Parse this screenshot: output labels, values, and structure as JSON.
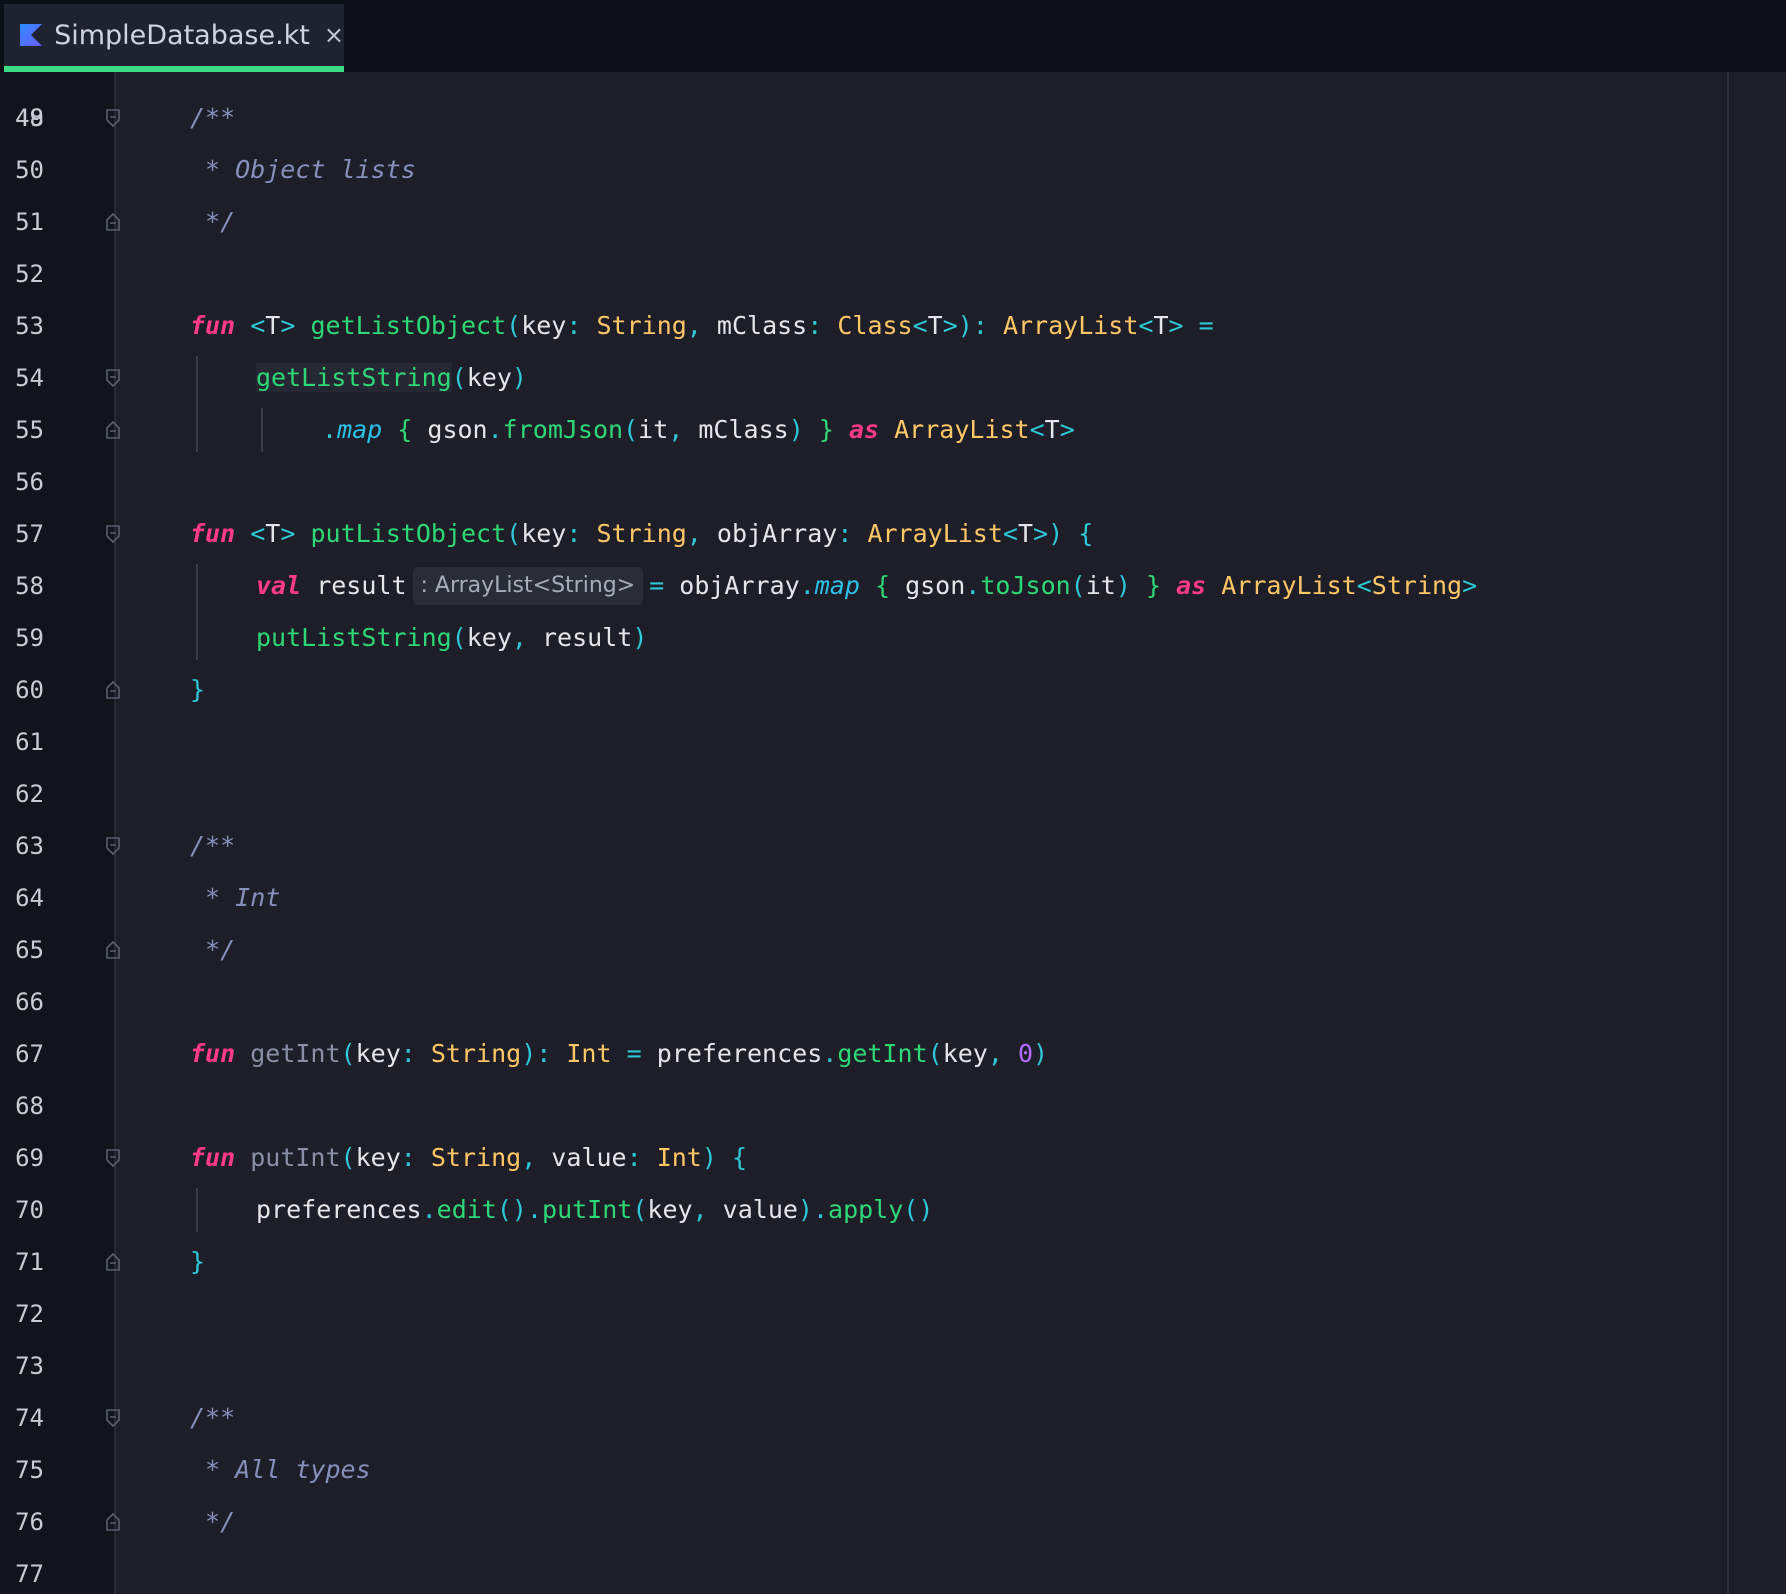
{
  "tab": {
    "title": "SimpleDatabase.kt",
    "close": "×"
  },
  "colors": {
    "background": "#1d1e27",
    "gutter": "#12141c",
    "tab_accent": "#3ddc84",
    "keyword": "#ff3a87",
    "type": "#ffc766",
    "function": "#2fd877",
    "punctuation": "#2ec8d6",
    "comment": "#8790bc",
    "number": "#b26cff"
  },
  "editor": {
    "partial_top_line": "48",
    "lines": [
      {
        "n": "49",
        "tokens": [
          [
            "cm",
            "/**"
          ]
        ]
      },
      {
        "n": "50",
        "tokens": [
          [
            "cm",
            " * Object lists"
          ]
        ]
      },
      {
        "n": "51",
        "tokens": [
          [
            "cm",
            " */"
          ]
        ]
      },
      {
        "n": "52",
        "tokens": []
      },
      {
        "n": "53",
        "tokens": [
          [
            "kw",
            "fun"
          ],
          [
            "id",
            " "
          ],
          [
            "pu",
            "<"
          ],
          [
            "id",
            "T"
          ],
          [
            "pu",
            ">"
          ],
          [
            "id",
            " "
          ],
          [
            "fn",
            "getListObject"
          ],
          [
            "pu",
            "("
          ],
          [
            "id",
            "key"
          ],
          [
            "pu",
            ":"
          ],
          [
            "id",
            " "
          ],
          [
            "ty",
            "String"
          ],
          [
            "pu",
            ","
          ],
          [
            "id",
            " mClass"
          ],
          [
            "pu",
            ":"
          ],
          [
            "id",
            " "
          ],
          [
            "ty",
            "Class"
          ],
          [
            "pu",
            "<"
          ],
          [
            "id",
            "T"
          ],
          [
            "pu",
            ">):"
          ],
          [
            "id",
            " "
          ],
          [
            "ty",
            "ArrayList"
          ],
          [
            "pu",
            "<"
          ],
          [
            "id",
            "T"
          ],
          [
            "pu",
            ">"
          ],
          [
            "id",
            " "
          ],
          [
            "pu",
            "="
          ]
        ]
      },
      {
        "n": "54",
        "tokens": [
          [
            "fn hl",
            "getListString"
          ],
          [
            "pu",
            "("
          ],
          [
            "id",
            "key"
          ],
          [
            "pu",
            ")"
          ]
        ]
      },
      {
        "n": "55",
        "tokens": [
          [
            "pu",
            "."
          ],
          [
            "it",
            "map"
          ],
          [
            "id",
            " "
          ],
          [
            "fn",
            "{"
          ],
          [
            "id",
            " gson"
          ],
          [
            "pu",
            "."
          ],
          [
            "fn",
            "fromJson"
          ],
          [
            "pu",
            "("
          ],
          [
            "id",
            "it"
          ],
          [
            "pu",
            ","
          ],
          [
            "id",
            " mClass"
          ],
          [
            "pu",
            ")"
          ],
          [
            "id",
            " "
          ],
          [
            "fn",
            "}"
          ],
          [
            "id",
            " "
          ],
          [
            "kw",
            "as"
          ],
          [
            "id",
            " "
          ],
          [
            "ty",
            "ArrayList"
          ],
          [
            "pu",
            "<"
          ],
          [
            "id",
            "T"
          ],
          [
            "pu",
            ">"
          ]
        ]
      },
      {
        "n": "56",
        "tokens": []
      },
      {
        "n": "57",
        "tokens": [
          [
            "kw",
            "fun"
          ],
          [
            "id",
            " "
          ],
          [
            "pu",
            "<"
          ],
          [
            "id",
            "T"
          ],
          [
            "pu",
            ">"
          ],
          [
            "id",
            " "
          ],
          [
            "fn",
            "putListObject"
          ],
          [
            "pu",
            "("
          ],
          [
            "id",
            "key"
          ],
          [
            "pu",
            ":"
          ],
          [
            "id",
            " "
          ],
          [
            "ty",
            "String"
          ],
          [
            "pu",
            ","
          ],
          [
            "id",
            " objArray"
          ],
          [
            "pu",
            ":"
          ],
          [
            "id",
            " "
          ],
          [
            "ty",
            "ArrayList"
          ],
          [
            "pu",
            "<"
          ],
          [
            "id",
            "T"
          ],
          [
            "pu",
            ">)"
          ],
          [
            "id",
            " "
          ],
          [
            "pu",
            "{"
          ]
        ]
      },
      {
        "n": "58",
        "tokens": [
          [
            "kw",
            "val"
          ],
          [
            "id",
            " result"
          ],
          [
            "hint",
            ": ArrayList<String>"
          ],
          [
            "pu",
            "="
          ],
          [
            "id",
            " objArray"
          ],
          [
            "pu",
            "."
          ],
          [
            "it",
            "map"
          ],
          [
            "id",
            " "
          ],
          [
            "fn",
            "{"
          ],
          [
            "id",
            " gson"
          ],
          [
            "pu",
            "."
          ],
          [
            "fn",
            "toJson"
          ],
          [
            "pu",
            "("
          ],
          [
            "id",
            "it"
          ],
          [
            "pu",
            ")"
          ],
          [
            "id",
            " "
          ],
          [
            "fn",
            "}"
          ],
          [
            "id",
            " "
          ],
          [
            "kw",
            "as"
          ],
          [
            "id",
            " "
          ],
          [
            "ty",
            "ArrayList"
          ],
          [
            "pu",
            "<"
          ],
          [
            "ty",
            "String"
          ],
          [
            "pu",
            ">"
          ]
        ]
      },
      {
        "n": "59",
        "tokens": [
          [
            "fn",
            "putListString"
          ],
          [
            "pu",
            "("
          ],
          [
            "id",
            "key"
          ],
          [
            "pu",
            ","
          ],
          [
            "id",
            " result"
          ],
          [
            "pu",
            ")"
          ]
        ]
      },
      {
        "n": "60",
        "tokens": [
          [
            "pu",
            "}"
          ]
        ]
      },
      {
        "n": "61",
        "tokens": []
      },
      {
        "n": "62",
        "tokens": []
      },
      {
        "n": "63",
        "tokens": [
          [
            "cm",
            "/**"
          ]
        ]
      },
      {
        "n": "64",
        "tokens": [
          [
            "cm",
            " * Int"
          ]
        ]
      },
      {
        "n": "65",
        "tokens": [
          [
            "cm",
            " */"
          ]
        ]
      },
      {
        "n": "66",
        "tokens": []
      },
      {
        "n": "67",
        "tokens": [
          [
            "kw",
            "fun"
          ],
          [
            "id",
            " "
          ],
          [
            "fnd",
            "getInt"
          ],
          [
            "pu",
            "("
          ],
          [
            "id",
            "key"
          ],
          [
            "pu",
            ":"
          ],
          [
            "id",
            " "
          ],
          [
            "ty",
            "String"
          ],
          [
            "pu",
            "):"
          ],
          [
            "id",
            " "
          ],
          [
            "ty",
            "Int"
          ],
          [
            "id",
            " "
          ],
          [
            "pu",
            "="
          ],
          [
            "id",
            " preferences"
          ],
          [
            "pu",
            "."
          ],
          [
            "fn",
            "getInt"
          ],
          [
            "pu",
            "("
          ],
          [
            "id",
            "key"
          ],
          [
            "pu",
            ","
          ],
          [
            "id",
            " "
          ],
          [
            "nu",
            "0"
          ],
          [
            "pu",
            ")"
          ]
        ]
      },
      {
        "n": "68",
        "tokens": []
      },
      {
        "n": "69",
        "tokens": [
          [
            "kw",
            "fun"
          ],
          [
            "id",
            " "
          ],
          [
            "fnd",
            "putInt"
          ],
          [
            "pu",
            "("
          ],
          [
            "id",
            "key"
          ],
          [
            "pu",
            ":"
          ],
          [
            "id",
            " "
          ],
          [
            "ty",
            "String"
          ],
          [
            "pu",
            ","
          ],
          [
            "id",
            " value"
          ],
          [
            "pu",
            ":"
          ],
          [
            "id",
            " "
          ],
          [
            "ty",
            "Int"
          ],
          [
            "pu",
            ")"
          ],
          [
            "id",
            " "
          ],
          [
            "pu",
            "{"
          ]
        ]
      },
      {
        "n": "70",
        "tokens": [
          [
            "id",
            "preferences"
          ],
          [
            "pu",
            "."
          ],
          [
            "fn",
            "edit"
          ],
          [
            "pu",
            "()."
          ],
          [
            "fn",
            "putInt"
          ],
          [
            "pu",
            "("
          ],
          [
            "id",
            "key"
          ],
          [
            "pu",
            ","
          ],
          [
            "id",
            " value"
          ],
          [
            "pu",
            ")."
          ],
          [
            "fn",
            "apply"
          ],
          [
            "pu",
            "()"
          ]
        ]
      },
      {
        "n": "71",
        "tokens": [
          [
            "pu",
            "}"
          ]
        ]
      },
      {
        "n": "72",
        "tokens": []
      },
      {
        "n": "73",
        "tokens": []
      },
      {
        "n": "74",
        "tokens": [
          [
            "cm",
            "/**"
          ]
        ]
      },
      {
        "n": "75",
        "tokens": [
          [
            "cm",
            " * All types"
          ]
        ]
      },
      {
        "n": "76",
        "tokens": [
          [
            "cm",
            " */"
          ]
        ]
      },
      {
        "n": "77",
        "tokens": []
      }
    ]
  }
}
